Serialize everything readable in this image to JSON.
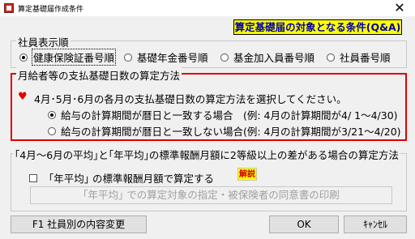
{
  "window": {
    "title": "算定基礎届作成条件",
    "close_glyph": "✕"
  },
  "qa_button_label": "算定基礎届の対象となる条件(Q&A)",
  "employee_order": {
    "legend": "社員表示順",
    "options": [
      {
        "label": "健康保険証番号順",
        "checked": true
      },
      {
        "label": "基礎年金番号順",
        "checked": false
      },
      {
        "label": "基金加入員番号順",
        "checked": false
      },
      {
        "label": "社員番号順",
        "checked": false
      }
    ]
  },
  "payment_days": {
    "legend": "月給者等の支払基礎日数の算定方法",
    "heart_glyph": "♥",
    "note": "4月･5月･6月の各月の支払基礎日数の算定方法を選択してください。",
    "options": [
      {
        "label": "給与の計算期間が暦日と一致する場合　(例: 4月の計算期間が4/ 1～4/30)",
        "checked": true
      },
      {
        "label": "給与の計算期間が暦日と一致しない場合(例: 4月の計算期間が3/21～4/20)",
        "checked": false
      }
    ]
  },
  "difference": {
    "legend": "｢4月～6月の平均｣と｢年平均｣の標準報酬月額に2等級以上の差がある場合の算定方法",
    "checkbox_label": "｢年平均｣ の標準報酬月額で算定する",
    "checkbox_checked": false,
    "explain_label": "解説",
    "print_button_label": "｢年平均｣ での算定対象の指定・被保険者の同意書の印刷"
  },
  "footer": {
    "f1_label": "F1  社員別の内容変更",
    "ok_label": "OK",
    "cancel_label": "ｷｬﾝｾﾙ"
  },
  "colors": {
    "highlight_border": "#e00000",
    "qa_bg": "#ffff00",
    "qa_text": "#0000b0",
    "explain_text": "#d00000"
  }
}
